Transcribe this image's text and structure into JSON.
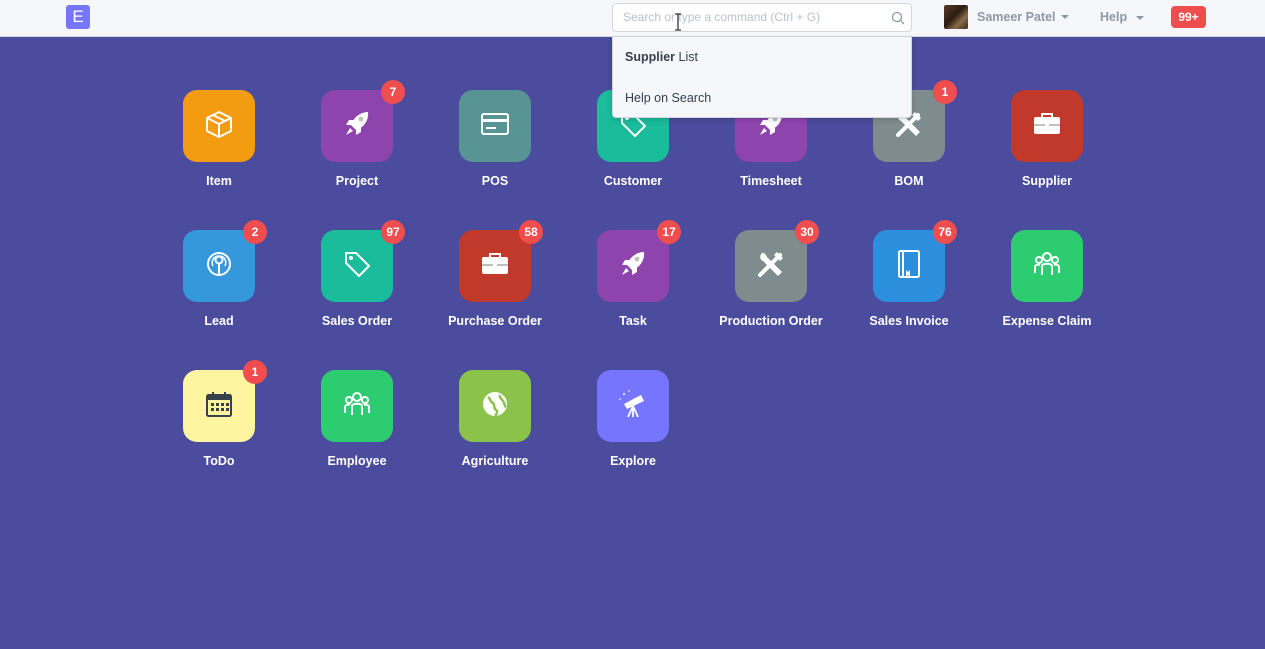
{
  "navbar": {
    "logo_letter": "E",
    "search": {
      "placeholder": "Search or type a command (Ctrl + G)",
      "value": ""
    },
    "user_name": "Sameer Patel",
    "help_label": "Help",
    "notifications_count": "99+"
  },
  "search_dropdown": {
    "item1_bold": "Supplier",
    "item1_rest": " List",
    "item2": "Help on Search"
  },
  "modules": [
    {
      "label": "Item",
      "icon": "box-icon",
      "color": "#f39c12",
      "badge": ""
    },
    {
      "label": "Project",
      "icon": "rocket-icon",
      "color": "#8e44ad",
      "badge": "7"
    },
    {
      "label": "POS",
      "icon": "credit-card-icon",
      "color": "#589494",
      "badge": ""
    },
    {
      "label": "Customer",
      "icon": "tag-icon",
      "color": "#1abc9c",
      "badge": ""
    },
    {
      "label": "Timesheet",
      "icon": "rocket-icon",
      "color": "#8e44ad",
      "badge": ""
    },
    {
      "label": "BOM",
      "icon": "tools-icon",
      "color": "#7f8c8d",
      "badge": "1"
    },
    {
      "label": "Supplier",
      "icon": "briefcase-icon",
      "color": "#c0392b",
      "badge": ""
    },
    {
      "label": "Lead",
      "icon": "lead-icon",
      "color": "#3498db",
      "badge": "2"
    },
    {
      "label": "Sales Order",
      "icon": "tag-icon",
      "color": "#1abc9c",
      "badge": "97"
    },
    {
      "label": "Purchase Order",
      "icon": "briefcase-icon",
      "color": "#c0392b",
      "badge": "58"
    },
    {
      "label": "Task",
      "icon": "rocket-icon",
      "color": "#8e44ad",
      "badge": "17"
    },
    {
      "label": "Production Order",
      "icon": "tools-icon",
      "color": "#7f8c8d",
      "badge": "30"
    },
    {
      "label": "Sales Invoice",
      "icon": "book-icon",
      "color": "#2b8fdd",
      "badge": "76"
    },
    {
      "label": "Expense Claim",
      "icon": "people-icon",
      "color": "#2ecc71",
      "badge": ""
    },
    {
      "label": "ToDo",
      "icon": "calendar-icon",
      "color": "#fff5a0",
      "badge": "1"
    },
    {
      "label": "Employee",
      "icon": "people-icon",
      "color": "#2ecc71",
      "badge": ""
    },
    {
      "label": "Agriculture",
      "icon": "globe-icon",
      "color": "#8bc34a",
      "badge": ""
    },
    {
      "label": "Explore",
      "icon": "telescope-icon",
      "color": "#7575ff",
      "badge": ""
    }
  ]
}
